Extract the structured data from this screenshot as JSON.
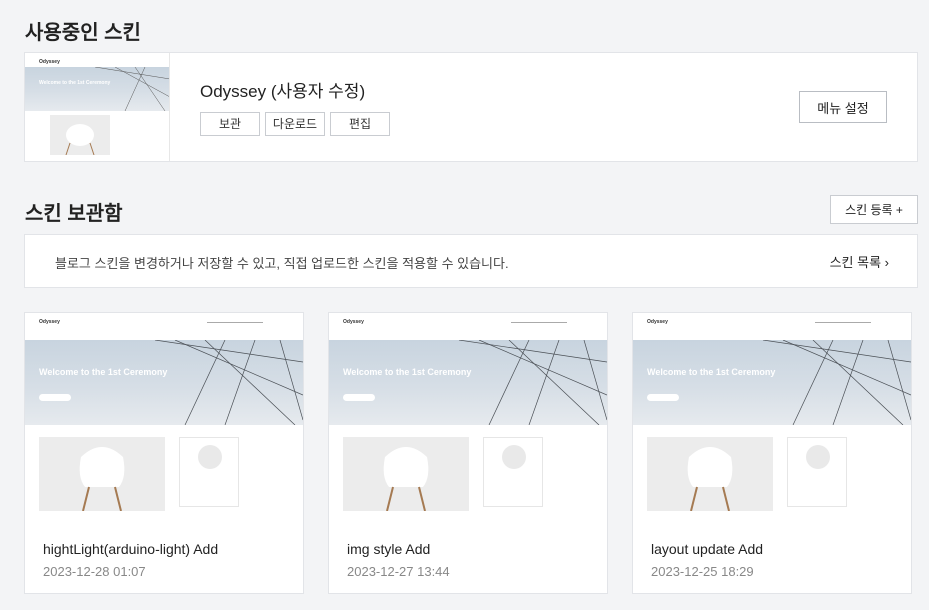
{
  "current": {
    "section_title": "사용중인 스킨",
    "skin_name": "Odyssey (사용자 수정)",
    "buttons": {
      "keep": "보관",
      "download": "다운로드",
      "edit": "편집"
    },
    "menu_button": "메뉴 설정"
  },
  "storage": {
    "section_title": "스킨 보관함",
    "register_button": "스킨 등록 +",
    "info_text": "블로그 스킨을 변경하거나 저장할 수 있고, 직접 업로드한 스킨을 적용할 수 있습니다.",
    "list_link": "스킨 목록 ›",
    "cards": [
      {
        "name": "hightLight(arduino-light) Add",
        "date": "2023-12-28 01:07"
      },
      {
        "name": "img style Add",
        "date": "2023-12-27 13:44"
      },
      {
        "name": "layout update Add",
        "date": "2023-12-25 18:29"
      }
    ]
  },
  "preview": {
    "logo": "Odyssey",
    "hero_text": "Welcome to the 1st Ceremony",
    "colors": {
      "hero": "#c8d4df",
      "chair_leg": "#a57a52"
    }
  }
}
